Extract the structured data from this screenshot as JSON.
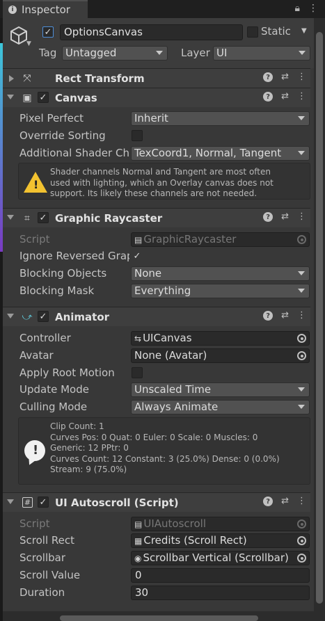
{
  "tab": {
    "title": "Inspector"
  },
  "header": {
    "object_name": "OptionsCanvas",
    "active": true,
    "static_label": "Static",
    "static_checked": false,
    "tag_label": "Tag",
    "tag_value": "Untagged",
    "layer_label": "Layer",
    "layer_value": "UI"
  },
  "rect_transform": {
    "title": "Rect Transform",
    "expanded": false
  },
  "canvas": {
    "title": "Canvas",
    "enabled": true,
    "pixel_perfect_label": "Pixel Perfect",
    "pixel_perfect_value": "Inherit",
    "override_sorting_label": "Override Sorting",
    "override_sorting_checked": false,
    "shader_channels_label": "Additional Shader Cha",
    "shader_channels_value": "TexCoord1, Normal, Tangent",
    "warning_text": "Shader channels Normal and Tangent are most often\nused with lighting, which an Overlay canvas does not\nsupport. Its likely these channels are not needed."
  },
  "graphic_raycaster": {
    "title": "Graphic Raycaster",
    "enabled": true,
    "script_label": "Script",
    "script_value": "GraphicRaycaster",
    "ignore_reversed_label": "Ignore Reversed Graph",
    "ignore_reversed_checked": true,
    "blocking_objects_label": "Blocking Objects",
    "blocking_objects_value": "None",
    "blocking_mask_label": "Blocking Mask",
    "blocking_mask_value": "Everything"
  },
  "animator": {
    "title": "Animator",
    "enabled": true,
    "controller_label": "Controller",
    "controller_value": "UICanvas",
    "avatar_label": "Avatar",
    "avatar_value": "None (Avatar)",
    "apply_root_motion_label": "Apply Root Motion",
    "apply_root_motion_checked": false,
    "update_mode_label": "Update Mode",
    "update_mode_value": "Unscaled Time",
    "culling_mode_label": "Culling Mode",
    "culling_mode_value": "Always Animate",
    "info_text": "Clip Count: 1\nCurves Pos: 0 Quat: 0 Euler: 0 Scale: 0 Muscles: 0\nGeneric: 12 PPtr: 0\nCurves Count: 12 Constant: 3 (25.0%) Dense: 0 (0.0%)\nStream: 9 (75.0%)"
  },
  "ui_autoscroll": {
    "title": "UI Autoscroll (Script)",
    "enabled": true,
    "script_label": "Script",
    "script_value": "UIAutoscroll",
    "scroll_rect_label": "Scroll Rect",
    "scroll_rect_value": "Credits (Scroll Rect)",
    "scrollbar_label": "Scrollbar",
    "scrollbar_value": "Scrollbar Vertical (Scrollbar)",
    "scroll_value_label": "Scroll Value",
    "scroll_value": "0",
    "duration_label": "Duration",
    "duration_value": "30"
  },
  "icons": {
    "info": "info-icon",
    "lock": "lock-icon",
    "menu": "kebab-menu-icon",
    "gameobject": "cube-icon",
    "help": "help-icon",
    "presets": "sliders-icon",
    "more": "kebab-menu-icon"
  },
  "colors": {
    "background": "#383838",
    "checkbox_accent": "#4e8ed8",
    "warning": "#f2c230"
  }
}
